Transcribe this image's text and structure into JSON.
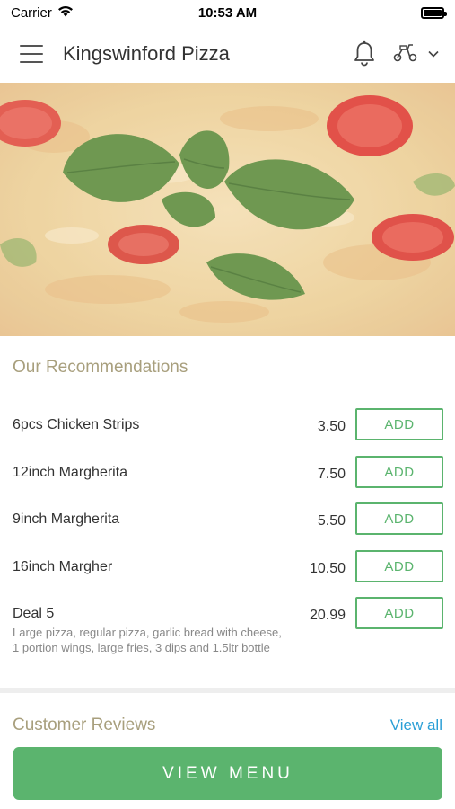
{
  "status_bar": {
    "carrier": "Carrier",
    "time": "10:53 AM"
  },
  "header": {
    "title": "Kingswinford Pizza",
    "icons": [
      "hamburger-menu-icon",
      "bell-icon",
      "scooter-icon",
      "chevron-down-icon"
    ]
  },
  "hero": {
    "description": "pizza-with-basil-and-tomatoes"
  },
  "recommendations": {
    "title": "Our Recommendations",
    "add_label": "ADD",
    "items": [
      {
        "name": "6pcs Chicken Strips",
        "price": "3.50",
        "description": ""
      },
      {
        "name": "12inch Margherita",
        "price": "7.50",
        "description": ""
      },
      {
        "name": "9inch Margherita",
        "price": "5.50",
        "description": ""
      },
      {
        "name": "16inch Margher",
        "price": "10.50",
        "description": ""
      },
      {
        "name": "Deal 5",
        "price": "20.99",
        "description": "Large pizza, regular pizza, garlic bread with cheese, 1 portion wings, large fries, 3 dips  and 1.5ltr bottle"
      }
    ]
  },
  "reviews": {
    "title": "Customer Reviews",
    "view_all": "View all"
  },
  "footer": {
    "view_menu": "VIEW MENU"
  },
  "colors": {
    "accent_green": "#5bb46e",
    "section_title": "#a89f7d",
    "link_blue": "#2a9fd6"
  }
}
